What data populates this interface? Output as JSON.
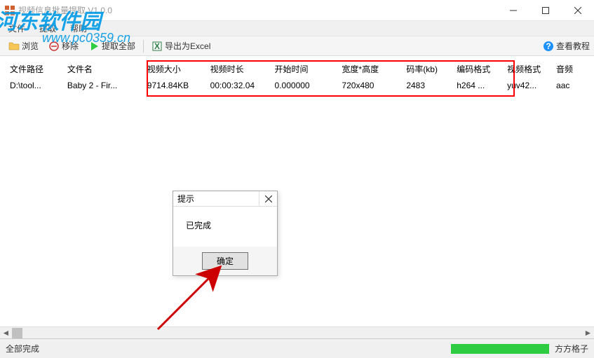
{
  "window": {
    "title": "视频信息批量提取   V1.0.0"
  },
  "menu": {
    "file": "文件",
    "extract": "提取",
    "help": "帮助"
  },
  "toolbar": {
    "browse": "浏览",
    "remove": "移除",
    "extract_all": "提取全部",
    "export_excel": "导出为Excel",
    "view_tutorial": "查看教程"
  },
  "grid": {
    "headers": {
      "path": "文件路径",
      "name": "文件名",
      "size": "视频大小",
      "duration": "视频时长",
      "start": "开始时间",
      "dimensions": "宽度*高度",
      "bitrate": "码率(kb)",
      "encoding": "编码格式",
      "vformat": "视频格式",
      "aformat": "音频"
    },
    "row": {
      "path": "D:\\tool...",
      "name": "Baby 2 - Fir...",
      "size": "9714.84KB",
      "duration": "00:00:32.04",
      "start": "0.000000",
      "dimensions": "720x480",
      "bitrate": "2483",
      "encoding": "h264 ...",
      "vformat": "yuv42...",
      "aformat": "aac"
    }
  },
  "dialog": {
    "title": "提示",
    "message": "已完成",
    "ok": "确定"
  },
  "status": {
    "text": "全部完成",
    "brand": "方方格子"
  },
  "watermark": {
    "name": "河东软件园",
    "url": "www.pc0359.cn"
  }
}
